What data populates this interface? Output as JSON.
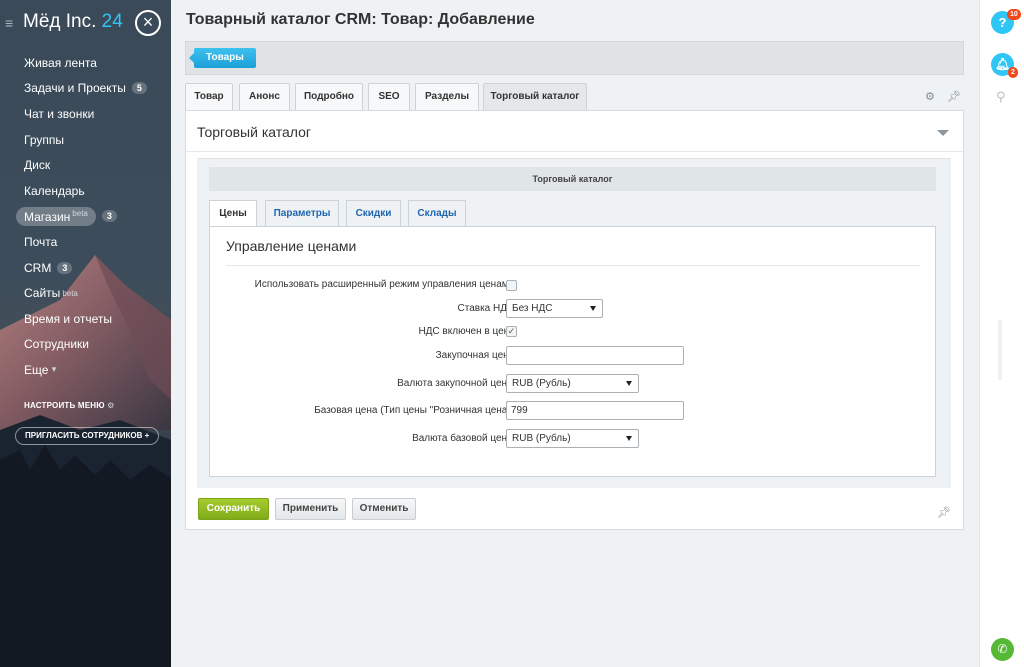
{
  "sidebar": {
    "logo_main": "Мёд Inc.",
    "logo_num": "24",
    "items": [
      {
        "label": "Живая лента"
      },
      {
        "label": "Задачи и Проекты",
        "count": "5"
      },
      {
        "label": "Чат и звонки"
      },
      {
        "label": "Группы"
      },
      {
        "label": "Диск"
      },
      {
        "label": "Календарь"
      },
      {
        "label": "Магазин",
        "sup": "beta",
        "count": "3"
      },
      {
        "label": "Почта"
      },
      {
        "label": "CRM",
        "count": "3"
      },
      {
        "label": "Сайты",
        "sup": "beta"
      },
      {
        "label": "Время и отчеты"
      },
      {
        "label": "Сотрудники"
      },
      {
        "label": "Еще",
        "suffix": "▾"
      }
    ],
    "configure_menu": "НАСТРОИТЬ МЕНЮ",
    "invite": "ПРИГЛАСИТЬ СОТРУДНИКОВ +"
  },
  "header": {
    "title": "Товарный каталог CRM: Товар: Добавление",
    "breadcrumb_button": "Товары"
  },
  "tabs": [
    "Товар",
    "Анонс",
    "Подробно",
    "SEO",
    "Разделы",
    "Торговый каталог"
  ],
  "panel": {
    "title": "Торговый каталог",
    "subheader": "Торговый каталог",
    "subtabs": [
      "Цены",
      "Параметры",
      "Скидки",
      "Склады"
    ],
    "section_title": "Управление ценами",
    "fields": {
      "extended_mode_label": "Использовать расширенный режим управления ценами:",
      "vat_rate_label": "Ставка НДС:",
      "vat_rate_value": "Без НДС",
      "vat_included_label": "НДС включен в цену:",
      "vat_included_checked": true,
      "purchase_price_label": "Закупочная цена:",
      "purchase_price_value": "",
      "purchase_currency_label": "Валюта закупочной цены:",
      "purchase_currency_value": "RUB (Рубль)",
      "base_price_label": "Базовая цена (Тип цены \"Розничная цена\"):",
      "base_price_value": "799",
      "base_currency_label": "Валюта базовой цены:",
      "base_currency_value": "RUB (Рубль)"
    }
  },
  "buttons": {
    "save": "Сохранить",
    "apply": "Применить",
    "cancel": "Отменить"
  },
  "rightbar": {
    "help_badge": "10",
    "notify_badge": "2"
  },
  "colors": {
    "accent": "#2fc6f6",
    "save_green": "#8bbb1e",
    "link_blue": "#2067b0",
    "badge_red": "#f54819"
  }
}
